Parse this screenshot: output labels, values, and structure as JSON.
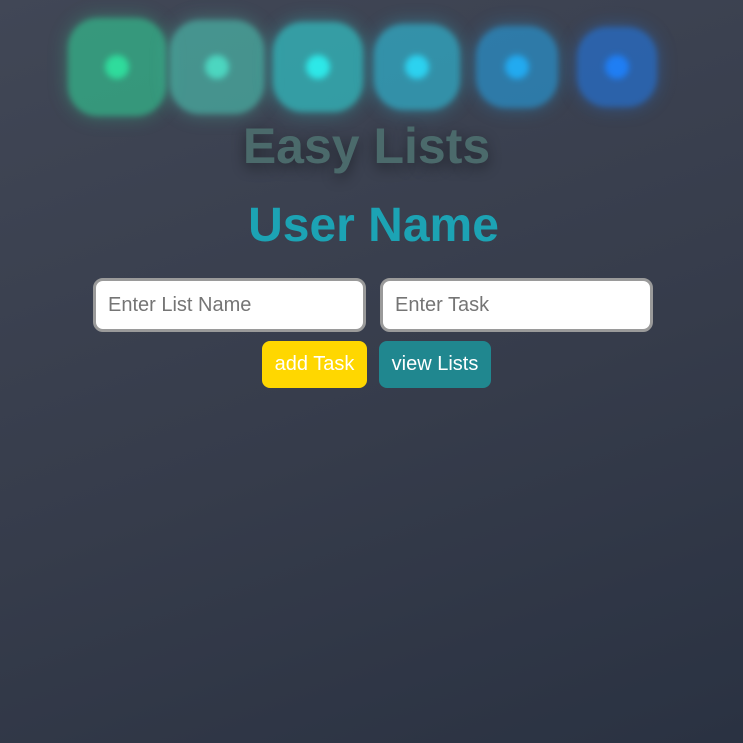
{
  "header": {
    "indicator_colors": [
      "#2fdc9c",
      "#4cd6c0",
      "#2de8e8",
      "#2cd2f0",
      "#22aaf0",
      "#1f7ef4"
    ],
    "title": "Easy Lists",
    "user_name": "User Name"
  },
  "form": {
    "list_name_placeholder": "Enter List Name",
    "list_name_value": "",
    "task_placeholder": "Enter Task",
    "task_value": ""
  },
  "actions": {
    "add_task_label": "add Task",
    "view_lists_label": "view Lists"
  }
}
